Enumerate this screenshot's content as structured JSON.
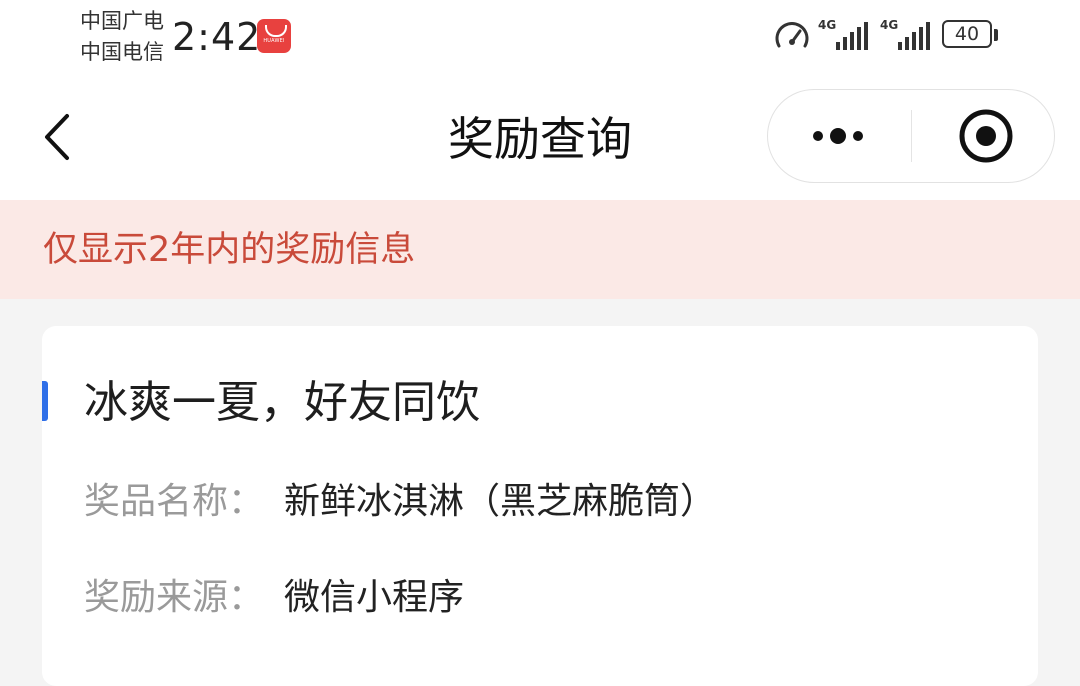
{
  "status_bar": {
    "carrier_1": "中国广电",
    "carrier_2": "中国电信",
    "time": "2:42",
    "app_badge_text": "HUAWEI",
    "signal_1_label": "4G",
    "signal_2_label": "4G",
    "battery_level": "40",
    "icons": [
      "speed-icon",
      "signal-icon",
      "signal-icon",
      "battery-icon"
    ]
  },
  "nav": {
    "back_icon": "chevron-left-icon",
    "title": "奖励查询",
    "more_icon": "more-dots-icon",
    "close_icon": "target-close-icon"
  },
  "notice": {
    "text": "仅显示2年内的奖励信息",
    "color": "#c94a3a",
    "background": "#fbe9e6"
  },
  "reward_card": {
    "title": "冰爽一夏，好友同饮",
    "accent_color": "#2f6fe8",
    "fields": [
      {
        "label": "奖品名称：",
        "value": "新鲜冰淇淋（黑芝麻脆筒）"
      },
      {
        "label": "奖励来源：",
        "value": "微信小程序"
      }
    ]
  }
}
